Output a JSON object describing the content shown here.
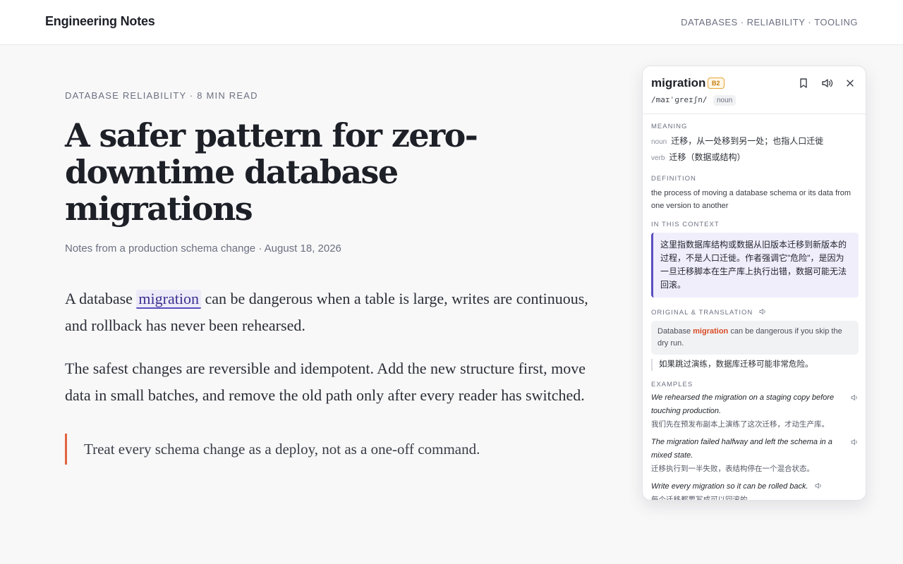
{
  "site": {
    "brand": "Engineering Notes",
    "nav": [
      "DATABASES",
      "RELIABILITY",
      "TOOLING"
    ]
  },
  "article": {
    "kicker": "DATABASE RELIABILITY · 8 MIN READ",
    "headline": "A safer pattern for zero-downtime database migrations",
    "byline": "Notes from a production schema change · August 18, 2026",
    "p1_before": "A database ",
    "p1_word": "migration",
    "p1_after": " can be dangerous when a table is large, writes are continuous, and rollback has never been rehearsed.",
    "p2": "The safest changes are reversible and idempotent. Add the new structure first, move data in small batches, and remove the old path only after every reader has switched.",
    "quote": "Treat every schema change as a deploy, not as a one-off command."
  },
  "popup": {
    "word": "migration",
    "level": "B2",
    "ipa": "/maɪˈɡreɪʃn/",
    "pos": "noun",
    "meaning_label": "MEANING",
    "meanings": [
      {
        "pos": "noun",
        "text": "迁移，从一处移到另一处；也指人口迁徙"
      },
      {
        "pos": "verb",
        "text": "迁移（数据或结构）"
      }
    ],
    "definition_label": "DEFINITION",
    "definition": "the process of moving a database schema or its data from one version to another",
    "context_label": "IN THIS CONTEXT",
    "context": "这里指数据库结构或数据从旧版本迁移到新版本的过程，不是人口迁徙。作者强调它\"危险\"，是因为一旦迁移脚本在生产库上执行出错，数据可能无法回滚。",
    "orig_label": "ORIGINAL & TRANSLATION",
    "orig_before": "Database ",
    "orig_word": "migration",
    "orig_after": " can be dangerous if you skip the dry run.",
    "translation": "如果跳过演练，数据库迁移可能非常危险。",
    "examples_label": "EXAMPLES",
    "examples": [
      {
        "en": "We rehearsed the migration on a staging copy before touching production.",
        "zh": "我们先在预发布副本上演练了这次迁移，才动生产库。"
      },
      {
        "en": "The migration failed halfway and left the schema in a mixed state.",
        "zh": "迁移执行到一半失败，表结构停在一个混合状态。"
      },
      {
        "en": "Write every migration so it can be rolled back.",
        "zh": "每个迁移都要写成可以回滚的。"
      }
    ]
  }
}
